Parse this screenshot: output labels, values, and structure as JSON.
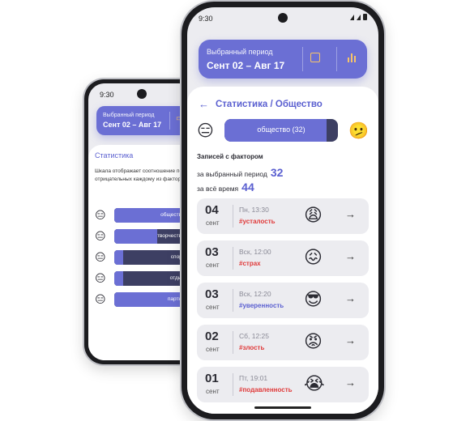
{
  "colors": {
    "accent": "#6b6fd4",
    "accent_dark": "#3d3f63",
    "tag_red": "#e03a3a",
    "tag_blue": "#5a5fd0",
    "icon_yellow": "#f6c36a"
  },
  "back_phone": {
    "time": "9:30",
    "period": {
      "label": "Выбранный период",
      "value": "Сент 02 – Авг 17"
    },
    "title": "Статистика",
    "description": "Шкала отображает соотношение положительных и отрицательных каждому из факторов за выбранн",
    "factors": [
      {
        "emoji": "😑",
        "label": "общество (32)",
        "fill": 0.78
      },
      {
        "emoji": "😑",
        "label": "творчество (20)",
        "fill": 0.48
      },
      {
        "emoji": "😑",
        "label": "спорт (12)",
        "fill": 0.1
      },
      {
        "emoji": "😑",
        "label": "отдых (12)",
        "fill": 0.1
      },
      {
        "emoji": "😑",
        "label": "партнер (7)",
        "fill": 1.0
      }
    ]
  },
  "front_phone": {
    "time": "9:30",
    "period": {
      "label": "Выбранный период",
      "value": "Сент 02 – Авг 17",
      "calendar_icon": "calendar-icon",
      "chart_icon": "bar-chart-icon"
    },
    "title": "Статистика / Общество",
    "factor": {
      "emoji_left": "😑",
      "label": "общество (32)",
      "emoji_right": "🫤",
      "fill": 0.9
    },
    "records_title": "Записей с фактором",
    "selected_period_label": "за выбранный период",
    "selected_period_count": "32",
    "all_time_label": "за всё время",
    "all_time_count": "44",
    "entries": [
      {
        "day": "04",
        "month": "сент",
        "when": "Пн, 13:30",
        "tag": "#усталость",
        "tag_color": "red",
        "emoji": "😩"
      },
      {
        "day": "03",
        "month": "сент",
        "when": "Вск, 12:00",
        "tag": "#страх",
        "tag_color": "red",
        "emoji": "😖"
      },
      {
        "day": "03",
        "month": "сент",
        "when": "Вск, 12:20",
        "tag": "#уверенность",
        "tag_color": "blue",
        "emoji": "😎"
      },
      {
        "day": "02",
        "month": "сент",
        "when": "Сб, 12:25",
        "tag": "#злость",
        "tag_color": "red",
        "emoji": "😡"
      },
      {
        "day": "01",
        "month": "сент",
        "when": "Пт, 19:01",
        "tag": "#подавленность",
        "tag_color": "red",
        "emoji": "😭"
      }
    ]
  }
}
